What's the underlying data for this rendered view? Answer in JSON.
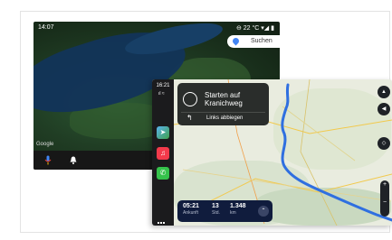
{
  "android_auto": {
    "time": "14:07",
    "status_right": "⊖ 22 °C ▾◢ ▮",
    "search_label": "Suchen",
    "map_attribution": "Google",
    "nav_chip": "Z",
    "bottom_icons": [
      "microphone-icon",
      "bell-icon"
    ]
  },
  "carplay": {
    "time": "16:21",
    "maneuver": {
      "title": "Starten auf Kranichweg",
      "subtitle": "Links abbiegen"
    },
    "trip": {
      "arrival_time": "05:21",
      "arrival_label": "Ankunft",
      "hours": "13",
      "hours_label": "Std.",
      "distance": "1.348",
      "distance_label": "km"
    },
    "dock_apps": [
      "maps-icon",
      "music-icon",
      "phone-icon"
    ],
    "colors": {
      "route": "#2f6fe0",
      "dock_background": "#1b1b1d",
      "eta_background": "#101c3d"
    }
  }
}
